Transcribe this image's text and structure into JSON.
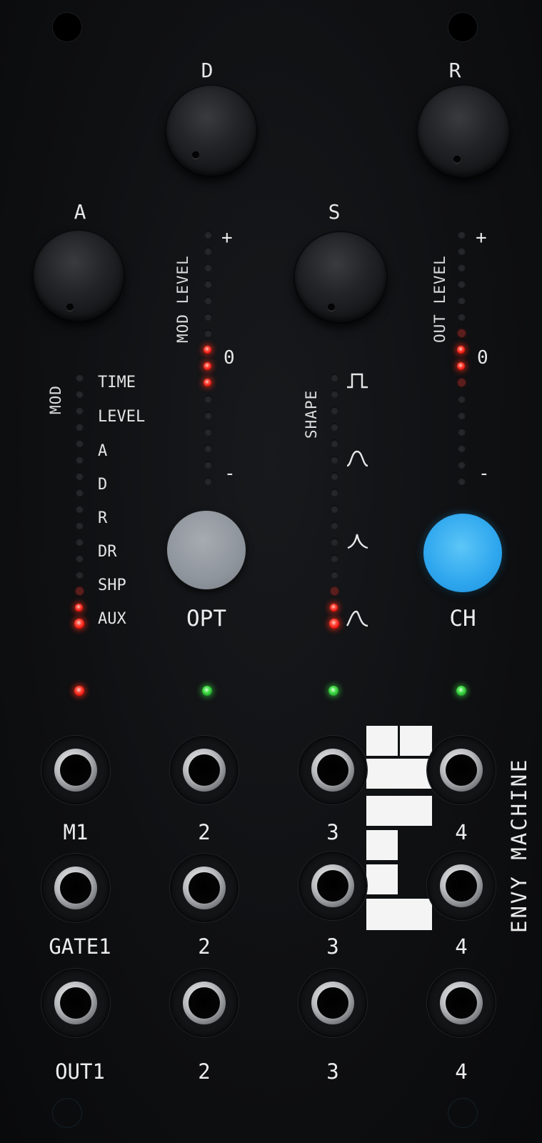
{
  "panel": {
    "brand": "ENVY MACHINE",
    "knobs": {
      "a": "A",
      "d": "D",
      "s": "S",
      "r": "R"
    },
    "mod_level": {
      "label": "MOD LEVEL",
      "plus": "+",
      "zero": "0",
      "minus": "-"
    },
    "out_level": {
      "label": "OUT LEVEL",
      "plus": "+",
      "zero": "0",
      "minus": "-"
    },
    "mod": {
      "label": "MOD",
      "items": [
        "TIME",
        "LEVEL",
        "A",
        "D",
        "R",
        "DR",
        "SHP",
        "AUX"
      ]
    },
    "shape": {
      "label": "SHAPE",
      "icons": [
        "square-shape-icon",
        "bell-shape-icon",
        "peak-shape-icon",
        "curve-shape-icon"
      ]
    },
    "buttons": {
      "opt": "OPT",
      "ch": "CH"
    },
    "channel_leds": [
      "red",
      "green",
      "green",
      "green"
    ],
    "jacks": {
      "row1": [
        "M1",
        "2",
        "3",
        "4"
      ],
      "row2": [
        "GATE1",
        "2",
        "3",
        "4"
      ],
      "row3": [
        "OUT1",
        "2",
        "3",
        "4"
      ]
    },
    "colors": {
      "button_grey": "#9aa0a6",
      "button_blue": "#35aaf0",
      "led_red": "#ff2a1a",
      "led_green": "#3ee04a"
    }
  }
}
